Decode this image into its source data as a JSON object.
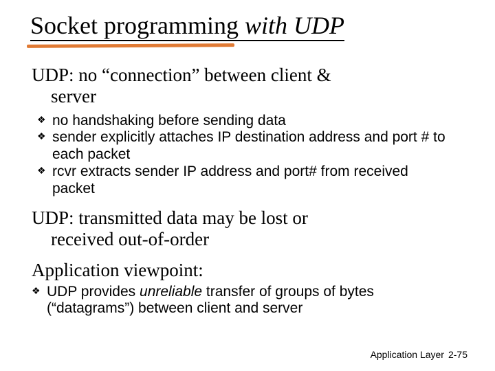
{
  "title": {
    "part1": "Socket programming ",
    "part2": "with UDP"
  },
  "subhead1_line1": "UDP: no “connection” between client &",
  "subhead1_line2": "server",
  "bullets1": [
    "no handshaking before sending data",
    "sender explicitly attaches IP destination address and port # to each packet",
    "rcvr extracts sender IP address and port# from received packet"
  ],
  "subhead2_line1": "UDP: transmitted data may be lost or",
  "subhead2_line2": "received out-of-order",
  "subhead3": "Application viewpoint:",
  "bullets2_prefix": "UDP provides ",
  "bullets2_em": "unreliable",
  "bullets2_suffix": " transfer of groups of bytes (“datagrams”) between client and server",
  "footer_label": "Application Layer",
  "footer_page": "2-75"
}
